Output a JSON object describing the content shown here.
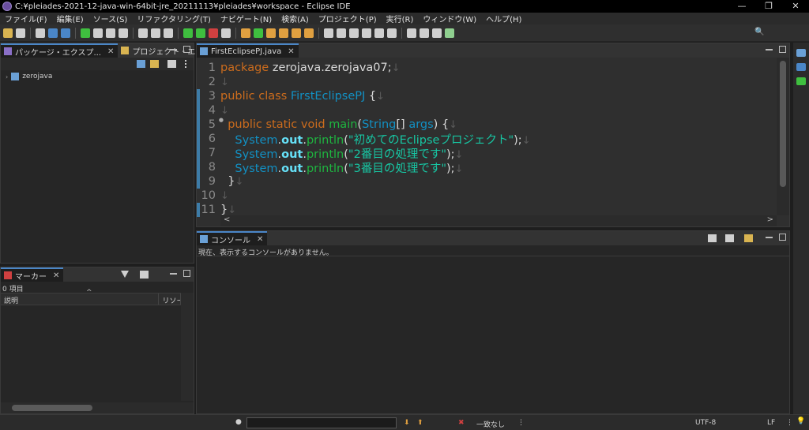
{
  "window": {
    "title": "C:¥pleiades-2021-12-java-win-64bit-jre_20211113¥pleiades¥workspace - Eclipse IDE",
    "controls": [
      "—",
      "❐",
      "✕"
    ]
  },
  "menu": [
    "ファイル(F)",
    "編集(E)",
    "ソース(S)",
    "リファクタリング(T)",
    "ナビゲート(N)",
    "検索(A)",
    "プロジェクト(P)",
    "実行(R)",
    "ウィンドウ(W)",
    "ヘルプ(H)"
  ],
  "toolbar": {
    "icon_colors": [
      "#d9b451",
      "#cfcfcf",
      "#cfcfcf",
      "#4a86c7",
      "#4a86c7",
      "#3fbf3f",
      "#cfcfcf",
      "#cfcfcf",
      "#cfcfcf",
      "#cfcfcf",
      "#cfcfcf",
      "#cfcfcf",
      "#3fbf3f",
      "#3fbf3f",
      "#d04040",
      "#cfcfcf",
      "#e0a040",
      "#3fbf3f",
      "#e0a040",
      "#e0a040",
      "#e0a040",
      "#e0a040",
      "#cfcfcf",
      "#cfcfcf",
      "#cfcfcf",
      "#cfcfcf",
      "#cfcfcf",
      "#cfcfcf",
      "#cfcfcf",
      "#cfcfcf",
      "#cfcfcf",
      "#8fcf8f"
    ],
    "search_icon": "🔍"
  },
  "package_explorer": {
    "tabs": [
      {
        "label": "パッケージ・エクスプ...",
        "close": "✕"
      },
      {
        "label": "プロジェクト・エクスプ..."
      }
    ],
    "tree": [
      {
        "label": "zerojava",
        "arrow": "›"
      }
    ]
  },
  "markers": {
    "tab_label": "マーカー",
    "close": "✕",
    "count": "0 項目",
    "columns": [
      "説明",
      "リソー"
    ],
    "sort_indicator": "^"
  },
  "editor": {
    "tab_label": "FirstEclipsePJ.java",
    "close": "✕",
    "lines": [
      {
        "n": "1",
        "parts": [
          {
            "t": "package",
            "c": "kw"
          },
          {
            "t": " zerojava.zerojava07;",
            "c": ""
          },
          {
            "t": "↓",
            "c": "mark"
          }
        ]
      },
      {
        "n": "2",
        "parts": [
          {
            "t": "↓",
            "c": "mark"
          }
        ]
      },
      {
        "n": "3",
        "parts": [
          {
            "t": "public",
            "c": "kw"
          },
          {
            "t": " ",
            "c": ""
          },
          {
            "t": "class",
            "c": "kw"
          },
          {
            "t": " FirstEclipsePJ",
            "c": "cls"
          },
          {
            "t": " {",
            "c": ""
          },
          {
            "t": "↓",
            "c": "mark"
          }
        ]
      },
      {
        "n": "4",
        "parts": [
          {
            "t": "↓",
            "c": "mark"
          }
        ]
      },
      {
        "n": "5",
        "parts": [
          {
            "t": "  public",
            "c": "kw"
          },
          {
            "t": " ",
            "c": ""
          },
          {
            "t": "static",
            "c": "kw"
          },
          {
            "t": " ",
            "c": ""
          },
          {
            "t": "void",
            "c": "kw"
          },
          {
            "t": " ",
            "c": ""
          },
          {
            "t": "main",
            "c": "fn"
          },
          {
            "t": "(",
            "c": ""
          },
          {
            "t": "String",
            "c": "cls"
          },
          {
            "t": "[] ",
            "c": ""
          },
          {
            "t": "args",
            "c": "cls"
          },
          {
            "t": ") {",
            "c": ""
          },
          {
            "t": "↓",
            "c": "mark"
          }
        ]
      },
      {
        "n": "6",
        "parts": [
          {
            "t": "    System",
            "c": "cls"
          },
          {
            "t": ".",
            "c": ""
          },
          {
            "t": "out",
            "c": "fld"
          },
          {
            "t": ".",
            "c": ""
          },
          {
            "t": "println",
            "c": "fn"
          },
          {
            "t": "(",
            "c": ""
          },
          {
            "t": "\"初めてのEclipseプロジェクト\"",
            "c": "str"
          },
          {
            "t": ");",
            "c": ""
          },
          {
            "t": "↓",
            "c": "mark"
          }
        ]
      },
      {
        "n": "7",
        "parts": [
          {
            "t": "    System",
            "c": "cls"
          },
          {
            "t": ".",
            "c": ""
          },
          {
            "t": "out",
            "c": "fld"
          },
          {
            "t": ".",
            "c": ""
          },
          {
            "t": "println",
            "c": "fn"
          },
          {
            "t": "(",
            "c": ""
          },
          {
            "t": "\"2番目の処理です\"",
            "c": "str"
          },
          {
            "t": ");",
            "c": ""
          },
          {
            "t": "↓",
            "c": "mark"
          }
        ]
      },
      {
        "n": "8",
        "parts": [
          {
            "t": "    System",
            "c": "cls"
          },
          {
            "t": ".",
            "c": ""
          },
          {
            "t": "out",
            "c": "fld"
          },
          {
            "t": ".",
            "c": ""
          },
          {
            "t": "println",
            "c": "fn"
          },
          {
            "t": "(",
            "c": ""
          },
          {
            "t": "\"3番目の処理です\"",
            "c": "str"
          },
          {
            "t": ");",
            "c": ""
          },
          {
            "t": "↓",
            "c": "mark"
          }
        ]
      },
      {
        "n": "9",
        "parts": [
          {
            "t": "  }",
            "c": ""
          },
          {
            "t": "↓",
            "c": "mark"
          }
        ]
      },
      {
        "n": "10",
        "parts": [
          {
            "t": "↓",
            "c": "mark"
          }
        ]
      },
      {
        "n": "11",
        "parts": [
          {
            "t": "}",
            "c": ""
          },
          {
            "t": "↓",
            "c": "mark"
          }
        ]
      }
    ],
    "fold_marker": "●",
    "scroll_left": "<",
    "scroll_right": ">"
  },
  "console": {
    "tab_label": "コンソール",
    "close": "✕",
    "message": "現在、表示するコンソールがありません。"
  },
  "statusbar": {
    "left_glyph": "●",
    "up": "⬆",
    "down": "⬇",
    "clear": "✖",
    "match": "一致なし",
    "encoding": "UTF-8",
    "line_ending": "LF",
    "more": "⋮",
    "bulb": "💡"
  },
  "colors": {
    "keyword": "#cc6c1d",
    "class": "#1290c3",
    "method": "#1eb540",
    "field": "#66e1f8",
    "string": "#17c6a3",
    "active_tab": "#4a86c7"
  }
}
